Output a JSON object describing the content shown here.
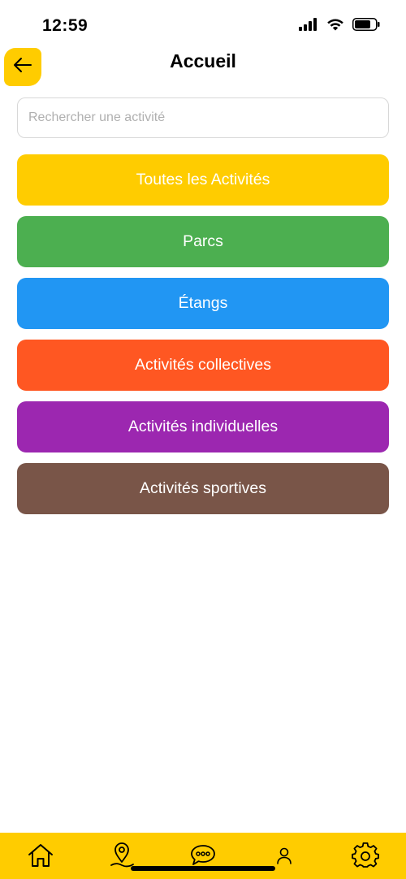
{
  "status_bar": {
    "time": "12:59"
  },
  "header": {
    "title": "Accueil"
  },
  "search": {
    "placeholder": "Rechercher une activité",
    "value": ""
  },
  "categories": [
    {
      "label": "Toutes les Activités",
      "color": "#FFCC00"
    },
    {
      "label": "Parcs",
      "color": "#4CAF50"
    },
    {
      "label": "Étangs",
      "color": "#2196F3"
    },
    {
      "label": "Activités collectives",
      "color": "#FF5722"
    },
    {
      "label": "Activités individuelles",
      "color": "#9C27B0"
    },
    {
      "label": "Activités sportives",
      "color": "#795548"
    }
  ],
  "tab_bar": {
    "background": "#FFCC00",
    "items": [
      "home-icon",
      "map-pin-icon",
      "chat-icon",
      "user-icon",
      "settings-icon"
    ]
  },
  "colors": {
    "accent": "#FFCC00"
  }
}
